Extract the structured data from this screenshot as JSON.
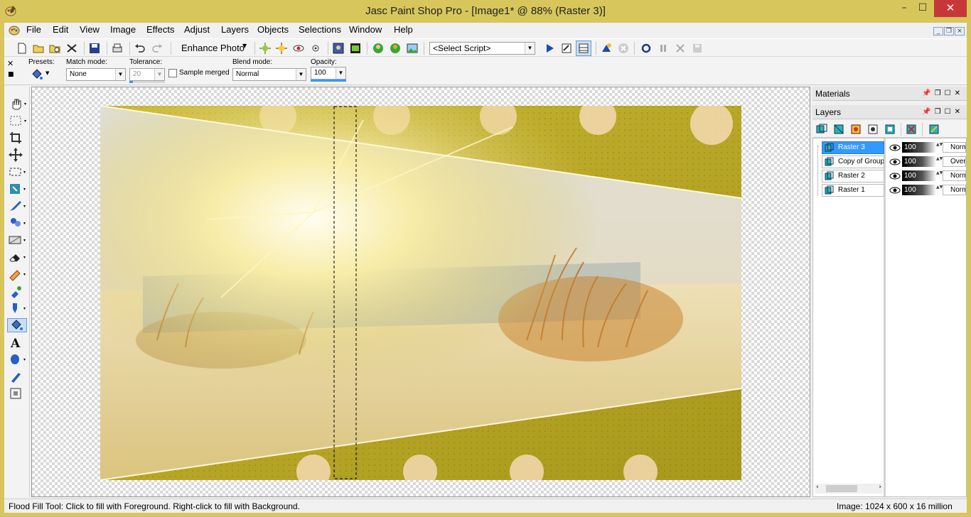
{
  "window": {
    "title": "Jasc Paint Shop Pro - [Image1* @  88% (Raster 3)]",
    "minimize_glyph": "–",
    "maximize_glyph": "☐",
    "close_glyph": "✕"
  },
  "menu": [
    {
      "label": "File"
    },
    {
      "label": "Edit"
    },
    {
      "label": "View"
    },
    {
      "label": "Image"
    },
    {
      "label": "Effects"
    },
    {
      "label": "Adjust"
    },
    {
      "label": "Layers"
    },
    {
      "label": "Objects"
    },
    {
      "label": "Selections"
    },
    {
      "label": "Window"
    },
    {
      "label": "Help"
    }
  ],
  "toolbar": {
    "enhance_photo_label": "Enhance Photo",
    "script_select_value": "<Select Script>"
  },
  "tool_options": {
    "presets_label": "Presets:",
    "match_mode_label": "Match mode:",
    "match_mode_value": "None",
    "tolerance_label": "Tolerance:",
    "tolerance_value": "20",
    "sample_merged_label": "Sample merged",
    "blend_mode_label": "Blend mode:",
    "blend_mode_value": "Normal",
    "opacity_label": "Opacity:",
    "opacity_value": "100"
  },
  "panels": {
    "materials_title": "Materials",
    "layers_title": "Layers"
  },
  "layers": [
    {
      "name": "Raster 3",
      "opacity": "100",
      "blend": "Norm",
      "selected": true
    },
    {
      "name": "Copy of Group",
      "opacity": "100",
      "blend": "Over",
      "selected": false
    },
    {
      "name": "Raster 2",
      "opacity": "100",
      "blend": "Norm",
      "selected": false
    },
    {
      "name": "Raster 1",
      "opacity": "100",
      "blend": "Norm",
      "selected": false
    }
  ],
  "status": {
    "hint": "Flood Fill Tool: Click to fill with Foreground. Right-click to fill with Background.",
    "image_info": "Image:  1024 x 600 x 16 million"
  },
  "colors": {
    "frame": "#d7c65b",
    "olive": "#b3a326",
    "selection_blue": "#3399ff",
    "close_red": "#c7373a"
  }
}
